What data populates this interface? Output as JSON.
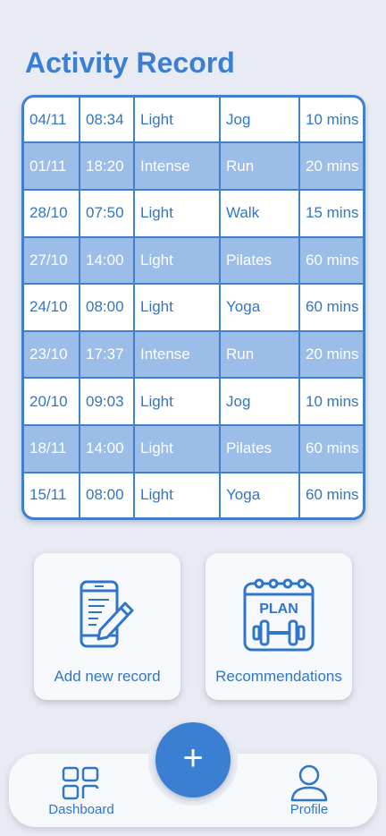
{
  "page": {
    "title": "Activity Record"
  },
  "records": [
    [
      "04/11",
      "08:34",
      "Light",
      "Jog",
      "10 mins"
    ],
    [
      "01/11",
      "18:20",
      "Intense",
      "Run",
      "20 mins"
    ],
    [
      "28/10",
      "07:50",
      "Light",
      "Walk",
      "15 mins"
    ],
    [
      "27/10",
      "14:00",
      "Light",
      "Pilates",
      "60 mins"
    ],
    [
      "24/10",
      "08:00",
      "Light",
      "Yoga",
      "60 mins"
    ],
    [
      "23/10",
      "17:37",
      "Intense",
      "Run",
      "20 mins"
    ],
    [
      "20/10",
      "09:03",
      "Light",
      "Jog",
      "10 mins"
    ],
    [
      "18/11",
      "14:00",
      "Light",
      "Pilates",
      "60 mins"
    ],
    [
      "15/11",
      "08:00",
      "Light",
      "Yoga",
      "60 mins"
    ]
  ],
  "cards": {
    "add": {
      "label": "Add new record",
      "icon": "phone-edit-icon"
    },
    "recommend": {
      "label": "Recommendations",
      "icon": "plan-calendar-icon",
      "icon_text": "PLAN"
    }
  },
  "nav": {
    "dashboard": {
      "label": "Dashboard",
      "icon": "grid-icon"
    },
    "add": {
      "label": "+",
      "icon": "plus-icon"
    },
    "profile": {
      "label": "Profile",
      "icon": "user-icon"
    }
  },
  "colors": {
    "accent": "#3a7fd2",
    "row_alt": "#9bbde8",
    "background": "#e8ebf3"
  }
}
